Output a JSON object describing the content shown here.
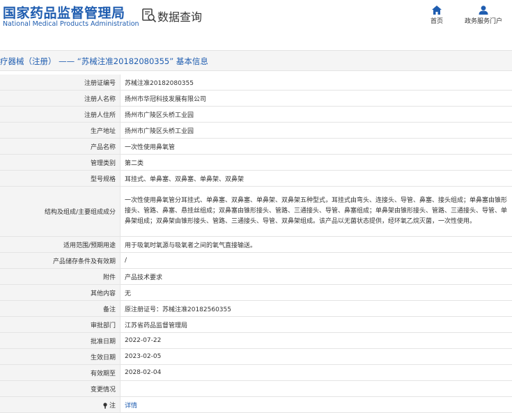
{
  "header": {
    "brand_cn": "国家药品监督管理局",
    "brand_en": "National Medical Products Administration",
    "query_title": "数据查询",
    "nav": [
      {
        "icon": "home-icon",
        "label": "首页"
      },
      {
        "icon": "user-icon",
        "label": "政务服务门户"
      }
    ]
  },
  "page_title": "疗器械（注册） —— “苏械注准20182080355” 基本信息",
  "rows": [
    {
      "label": "注册证编号",
      "value": "苏械注准20182080355"
    },
    {
      "label": "注册人名称",
      "value": "扬州市华冠科技发展有限公司"
    },
    {
      "label": "注册人住所",
      "value": "扬州市广陵区头桥工业园"
    },
    {
      "label": "生产地址",
      "value": "扬州市广陵区头桥工业园"
    },
    {
      "label": "产品名称",
      "value": "一次性使用鼻氧管"
    },
    {
      "label": "管理类别",
      "value": "第二类"
    },
    {
      "label": "型号规格",
      "value": "耳挂式、单鼻塞、双鼻塞、单鼻架、双鼻架"
    },
    {
      "label": "结构及组成/主要组成成分",
      "value": "一次性使用鼻氧管分耳挂式、单鼻塞、双鼻塞、单鼻架、双鼻架五种型式，耳挂式由弯头、连接头、导管、鼻塞、接头组成；单鼻塞由锥形接头、管路、鼻塞、悬挂丝组成；双鼻塞由锥形接头、管路、三通接头、导管、鼻塞组成；单鼻架由锥形接头、管路、三通接头、导管、单鼻架组成；双鼻架由锥形接头、管路、三通接头、导管、双鼻架组成。该产品以无菌状态提供，经环氧乙烷灭菌，一次性使用。"
    },
    {
      "label": "适用范围/预期用途",
      "value": "用于吸氧时氧源与吸氧者之间的氧气直接输送。"
    },
    {
      "label": "产品储存条件及有效期",
      "value": "/"
    },
    {
      "label": "附件",
      "value": "产品技术要求"
    },
    {
      "label": "其他内容",
      "value": "无"
    },
    {
      "label": "备注",
      "value": "原注册证号：苏械注准20182560355"
    },
    {
      "label": "审批部门",
      "value": "江苏省药品监督管理局"
    },
    {
      "label": "批准日期",
      "value": "2022-07-22"
    },
    {
      "label": "生效日期",
      "value": "2023-02-05"
    },
    {
      "label": "有效期至",
      "value": "2028-02-04"
    },
    {
      "label": "变更情况",
      "value": ""
    }
  ],
  "note_row": {
    "label": "注",
    "link": "详情",
    "icon": "note-icon"
  }
}
